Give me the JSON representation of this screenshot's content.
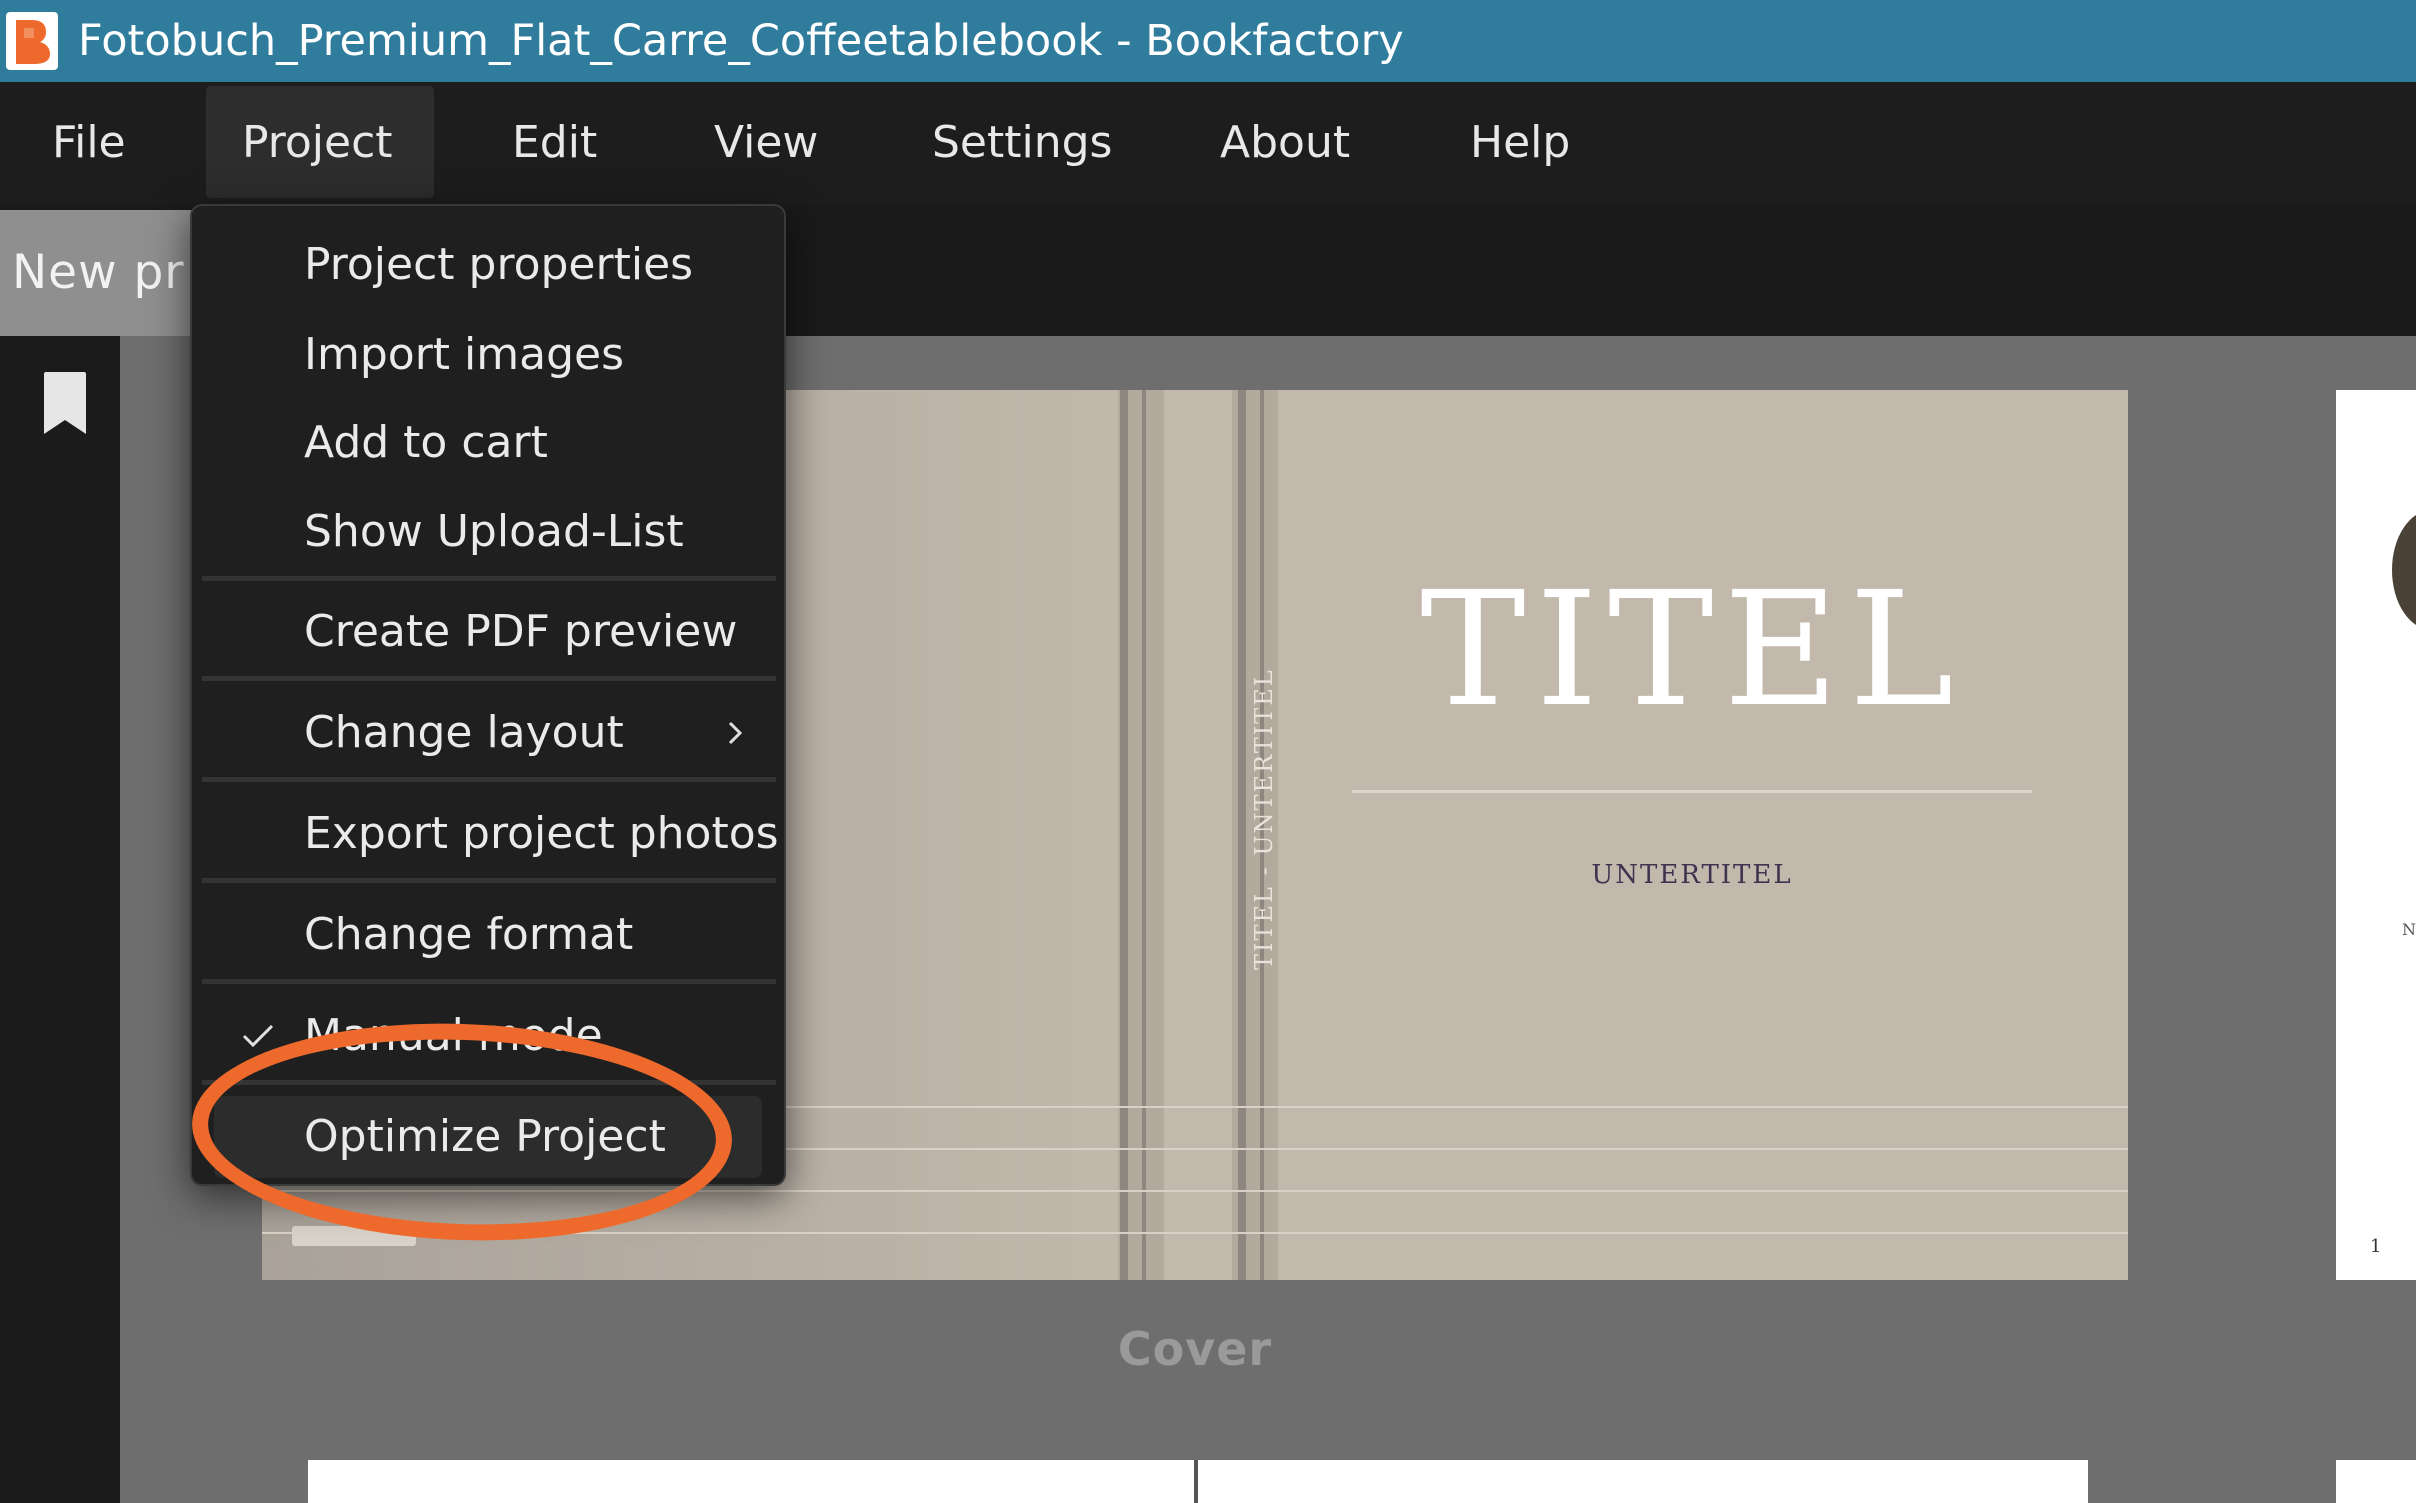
{
  "window": {
    "title": "Fotobuch_Premium_Flat_Carre_Coffeetablebook - Bookfactory",
    "app_icon": "bookfactory-logo-icon",
    "brand_color": "#ee6a2c",
    "titlebar_color": "#2f7c9c"
  },
  "menubar": {
    "items": [
      {
        "label": "File"
      },
      {
        "label": "Project"
      },
      {
        "label": "Edit"
      },
      {
        "label": "View"
      },
      {
        "label": "Settings"
      },
      {
        "label": "About"
      },
      {
        "label": "Help"
      }
    ],
    "active_item": "Project"
  },
  "tabbar": {
    "tab_label": "New pr"
  },
  "sidebar": {
    "icon": "bookmark-icon"
  },
  "project_menu": {
    "items": [
      {
        "label": "Project properties"
      },
      {
        "label": "Import images"
      },
      {
        "label": "Add to cart"
      },
      {
        "label": "Show Upload-List"
      },
      {
        "label": "Create PDF preview"
      },
      {
        "label": "Change layout",
        "has_submenu": true
      },
      {
        "label": "Export project photos"
      },
      {
        "label": "Change format"
      },
      {
        "label": "Manual mode",
        "checked": true
      },
      {
        "label": "Optimize Project",
        "highlighted": true
      }
    ],
    "submenu_icon": "chevron-right-icon",
    "check_icon": "checkmark-icon"
  },
  "cover": {
    "title": "TITEL",
    "subtitle": "UNTERTITEL",
    "spine_text": "TITEL - UNTERTITEL",
    "label": "Cover"
  },
  "right_page": {
    "page_number": "1",
    "partial_text": "N"
  },
  "annotation": {
    "highlight_color": "#ee6a2c",
    "target": "Optimize Project"
  }
}
